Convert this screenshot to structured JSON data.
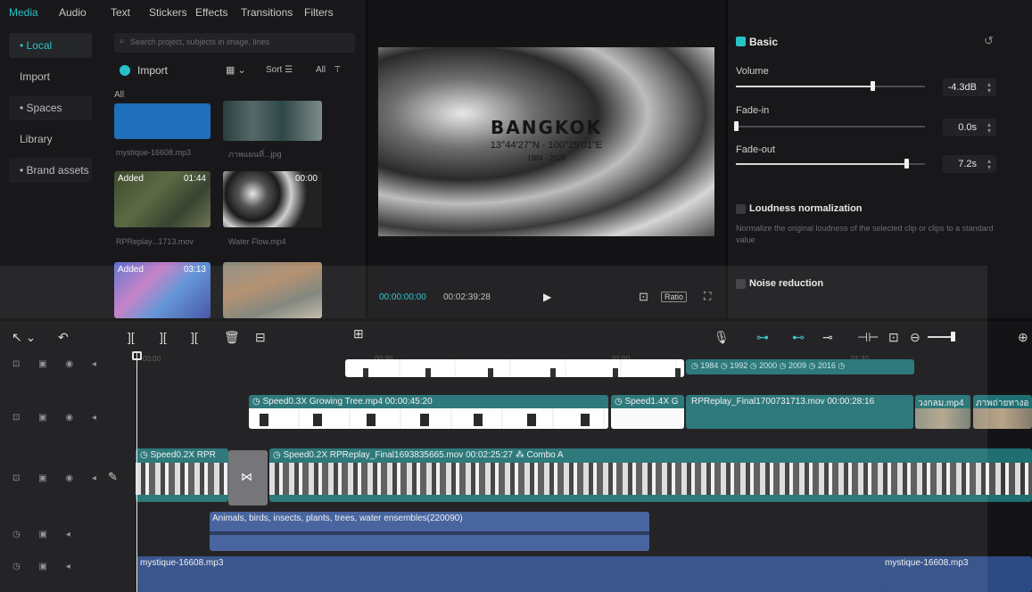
{
  "top_tabs": [
    "Media",
    "Audio",
    "Text",
    "Stickers",
    "Effects",
    "Transitions",
    "Filters"
  ],
  "nav": {
    "items": [
      "• Local",
      "Import",
      "• Spaces",
      "Library",
      "• Brand assets"
    ]
  },
  "media": {
    "search_placeholder": "Search project, subjects in image, lines",
    "import_label": "Import",
    "sort_label": "Sort",
    "all_filter": "All",
    "section_all": "All",
    "thumbs": [
      {
        "caption": "mystique-16608.mp3",
        "badge": "",
        "duration": ""
      },
      {
        "caption": "ภาพแผนที่...jpg",
        "badge": "",
        "duration": ""
      },
      {
        "caption": "RPReplay...1713.mov",
        "badge": "Added",
        "duration": "01:44"
      },
      {
        "caption": "Water Flow.mp4",
        "badge": "",
        "duration": "00:00"
      },
      {
        "caption": "",
        "badge": "Added",
        "duration": "03:13"
      },
      {
        "caption": "",
        "badge": "",
        "duration": ""
      }
    ]
  },
  "preview": {
    "title": "BANGKOK",
    "coords": "13°44'27\"N · 100°25'01\"E",
    "years": "1984 - 2023",
    "current_time": "00:00:00:00",
    "total_time": "00:02:39:28",
    "ratio_label": "Ratio"
  },
  "properties": {
    "section_title": "Basic",
    "volume_label": "Volume",
    "volume_value": "-4.3dB",
    "volume_level": 0.72,
    "fadein_label": "Fade-in",
    "fadein_value": "0.0s",
    "fadein_level": 0.0,
    "fadeout_label": "Fade-out",
    "fadeout_value": "7.2s",
    "fadeout_level": 0.9,
    "loudness_label": "Loudness normalization",
    "loudness_desc": "Normalize the original loudness of the selected clip or clips to a standard value",
    "noise_label": "Noise reduction"
  },
  "timeline": {
    "ruler": [
      "00:00",
      "00:30",
      "01:00",
      "01:30"
    ],
    "year_labels": "◷ 1984  ◷ 1992  ◷ 2000  ◷ 2009  ◷ 2016  ◷",
    "clip1_label": "◷ Speed0.3X  Growing Tree.mp4  00:00:45:20",
    "clip2_label": "◷ Speed1.4X  G",
    "clip3_label": "RPReplay_Final1700731713.mov  00:00:28:16",
    "clip4_label": "วงกลม.mp4",
    "clip5_label": "ภาพถ่ายทางอ",
    "main_clip_a": "◷ Speed0.2X  RPR",
    "main_clip_b": "◷ Speed0.2X  RPReplay_Final1693835665.mov  00:02:25:27  ⁂ Combo A",
    "audio1_label": "Animals, birds, insects, plants, trees, water ensembles(220090)",
    "audio2_label": "mystique-16608.mp3",
    "audio3_label": "mystique-16608.mp3"
  },
  "colors": {
    "accent": "#27c2c7",
    "teal_clip": "#1f6f72",
    "audio_blue": "#3c5a99",
    "panel": "#18181b"
  }
}
